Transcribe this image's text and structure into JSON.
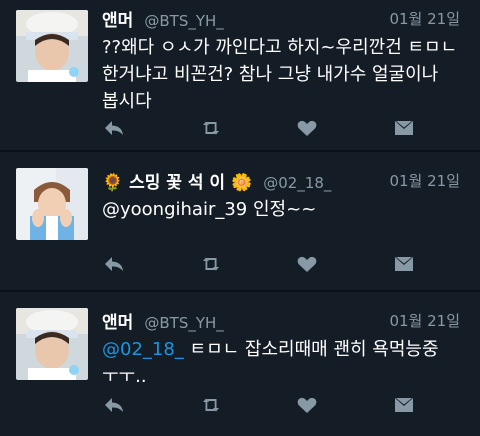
{
  "tweets": [
    {
      "name": "앤머",
      "handle": "@BTS_YH_",
      "date": "01월 21일",
      "text": "??왜다 ㅇㅅ가 까인다고 하지~우리깐건 ㅌㅁㄴ\n한거냐고 비꼰건? 참나 그냥 내가수 얼굴이나\n봅시다"
    },
    {
      "name_emoji_left": "🌻",
      "name": "스밍 꽃 석 이",
      "name_emoji_right": "🌼",
      "handle": "@02_18_",
      "date": "01월 21일",
      "mention": "@yoongihair_39",
      "text_after": " 인정~~"
    },
    {
      "name": "앤머",
      "handle": "@BTS_YH_",
      "date": "01월 21일",
      "mention": "@02_18_",
      "text_after": " ㅌㅁㄴ 잡소리때매 괜히 욕먹능중\nㅜㅜ.."
    }
  ],
  "icons": {
    "reply": "reply-icon",
    "retweet": "retweet-icon",
    "like": "heart-icon",
    "message": "direct-message-icon"
  },
  "colors": {
    "background": "#141d26",
    "secondary_text": "#8899a6",
    "link": "#1b95e0",
    "action_icon": "#8899a6"
  }
}
